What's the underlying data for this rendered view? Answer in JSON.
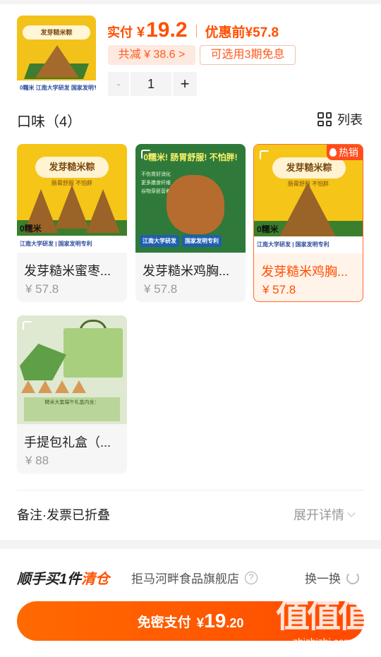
{
  "product": {
    "thumb": {
      "banner": "发芽糙米粽",
      "footer": "0糯米  江南大学研发 国家发明专利"
    },
    "price_label": "实付",
    "currency": "¥",
    "price": "19.2",
    "orig_price_label": "优惠前",
    "orig_price": "¥57.8",
    "discount_tag": "共减 ¥ 38.6 >",
    "installment_tag": "可选用3期免息",
    "quantity": "1",
    "minus": "-",
    "plus": "+"
  },
  "flavor": {
    "title": "口味（4）",
    "list_label": "列表",
    "options": [
      {
        "name": "发芽糙米蜜枣...",
        "price": "¥ 57.8",
        "selected": false,
        "img": {
          "ribbon": "发芽糙米粽",
          "sub": "肠胃舒服  不怕胖",
          "zero": "0糯米",
          "bottom": "江南大学研发 | 国家发明专利"
        }
      },
      {
        "name": "发芽糙米鸡胸...",
        "price": "¥ 57.8",
        "selected": false,
        "img": {
          "head": "0糯米! 肠胃舒服! 不怕胖!",
          "features": "不伤胃好消化\n更多膳食纤维\n谷物芽胚营养健康",
          "badge1": "江南大学研发",
          "badge2": "国家发明专利"
        }
      },
      {
        "name": "发芽糙米鸡胸...",
        "price": "¥ 57.8",
        "selected": true,
        "hot_label": "热销",
        "img": {
          "ribbon": "发芽糙米粽",
          "sub": "肠胃舒服  不怕胖",
          "zero": "0糯米",
          "bottom": "江南大学研发 | 国家发明专利"
        }
      },
      {
        "name": "手提包礼盒（...",
        "price": "¥ 88",
        "selected": false,
        "img": {
          "panel": "糙米大套端午礼盒内含："
        }
      }
    ]
  },
  "remark": {
    "label": "备注·发票已折叠",
    "expand": "展开详情"
  },
  "addon": {
    "title_a": "顺手买1件",
    "title_b": "清仓",
    "store": "拒马河畔食品旗舰店",
    "help": "?",
    "swap": "换一换"
  },
  "pay": {
    "label": "免密支付",
    "currency": "¥",
    "int": "19",
    "dec": ".20"
  },
  "watermark": {
    "big": "值值值",
    "small": "zhizhizhi.com"
  },
  "colors": {
    "accent": "#ff5000",
    "hot": "#ff4d1c"
  }
}
